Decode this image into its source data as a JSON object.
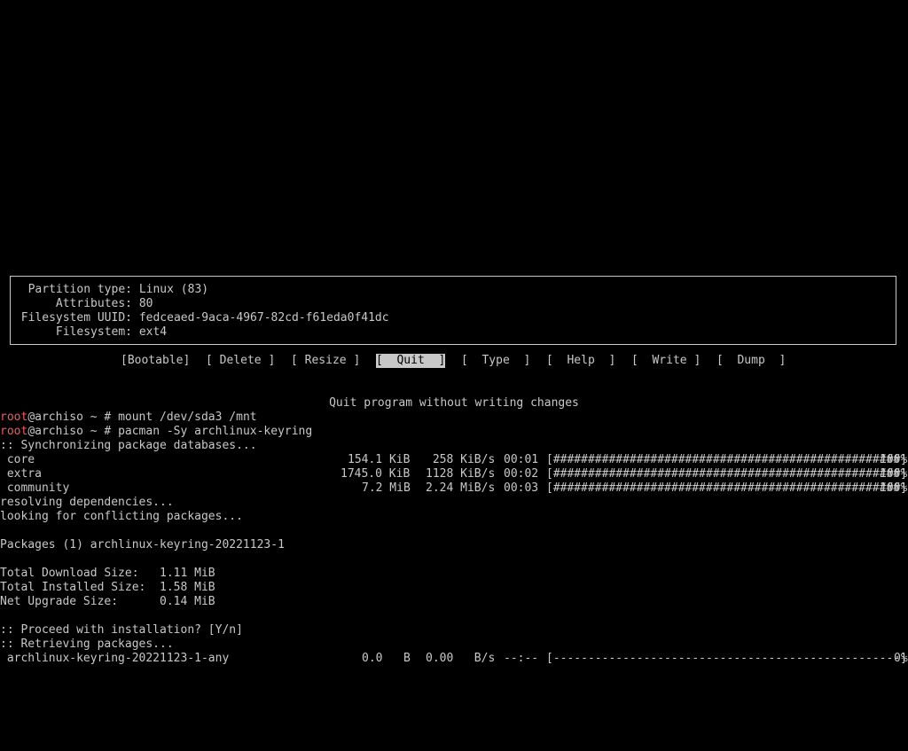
{
  "partition_info": {
    "rows": [
      {
        "key": "Partition type:",
        "value": "Linux (83)"
      },
      {
        "key": "Attributes:",
        "value": "80"
      },
      {
        "key": "Filesystem UUID:",
        "value": "fedceaed-9aca-4967-82cd-f61eda0f41dc"
      },
      {
        "key": "Filesystem:",
        "value": "ext4"
      }
    ]
  },
  "menu": {
    "bootable": "[Bootable]",
    "delete": "[ Delete ]",
    "resize": "[ Resize ]",
    "quit": "[  Quit  ]",
    "type": "[  Type  ]",
    "help": "[  Help  ]",
    "write": "[  Write ]",
    "dump": "[  Dump  ]",
    "selected": "quit"
  },
  "status_text": "Quit program without writing changes",
  "terminal": {
    "prompt_user": "root",
    "prompt_rest": "@archiso ~ # ",
    "cmd1": "mount /dev/sda3 /mnt",
    "cmd2": "pacman -Sy archlinux-keyring",
    "sync": ":: Synchronizing package databases...",
    "repos": [
      {
        "name": " core",
        "size": "154.1 KiB",
        "rate": " 258 KiB/s",
        "time": "00:01",
        "bar": "[##################################################]",
        "pct": "100%"
      },
      {
        "name": " extra",
        "size": "1745.0 KiB",
        "rate": "1128 KiB/s",
        "time": "00:02",
        "bar": "[##################################################]",
        "pct": "100%"
      },
      {
        "name": " community",
        "size": "7.2 MiB",
        "rate": "2.24 MiB/s",
        "time": "00:03",
        "bar": "[##################################################]",
        "pct": "100%"
      }
    ],
    "resolving": "resolving dependencies...",
    "conflicts": "looking for conflicting packages...",
    "packages": "Packages (1) archlinux-keyring-20221123-1",
    "total_download": "Total Download Size:   1.11 MiB",
    "total_installed": "Total Installed Size:  1.58 MiB",
    "net_upgrade": "Net Upgrade Size:      0.14 MiB",
    "proceed": ":: Proceed with installation? [Y/n]",
    "retrieving": ":: Retrieving packages...",
    "download": {
      "name": " archlinux-keyring-20221123-1-any",
      "size": "0.0   B",
      "rate": "0.00   B/s",
      "time": "--:--",
      "bar": "[--------------------------------------------------]",
      "pct": "0%"
    }
  },
  "colors": {
    "background": "#000000",
    "foreground": "#c8c8c8",
    "prompt_user": "#ff5555"
  }
}
